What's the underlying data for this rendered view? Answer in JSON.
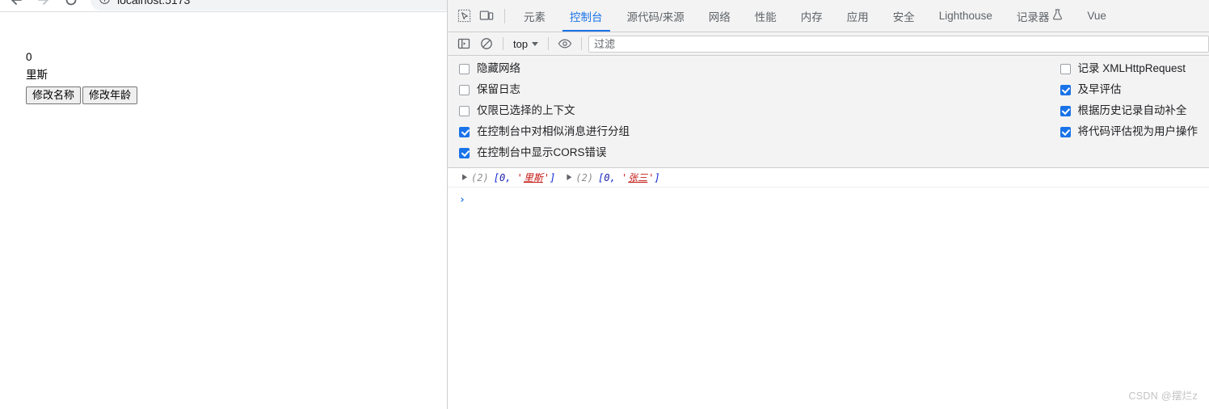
{
  "browser": {
    "url_text": "localhost:5173",
    "back_icon": "back-arrow-icon",
    "forward_icon": "forward-arrow-icon",
    "reload_icon": "reload-icon",
    "info_icon": "info-circle-icon"
  },
  "page": {
    "age_value": "0",
    "name_value": "里斯",
    "buttons": [
      {
        "label": "修改名称",
        "name": "change-name-button"
      },
      {
        "label": "修改年龄",
        "name": "change-age-button"
      }
    ]
  },
  "devtools": {
    "tabs": [
      {
        "label": "元素",
        "active": false
      },
      {
        "label": "控制台",
        "active": true
      },
      {
        "label": "源代码/来源",
        "active": false
      },
      {
        "label": "网络",
        "active": false
      },
      {
        "label": "性能",
        "active": false
      },
      {
        "label": "内存",
        "active": false
      },
      {
        "label": "应用",
        "active": false
      },
      {
        "label": "安全",
        "active": false
      },
      {
        "label": "Lighthouse",
        "active": false
      },
      {
        "label": "记录器",
        "active": false,
        "icon": "flask-icon"
      },
      {
        "label": "Vue",
        "active": false
      }
    ],
    "tabbar_icons": [
      {
        "name": "inspect-element-icon"
      },
      {
        "name": "device-toolbar-icon"
      }
    ],
    "console_toolbar": {
      "sidebar_toggle_icon": "console-sidebar-icon",
      "clear_console_icon": "clear-console-icon",
      "context_label": "top",
      "live_expression_icon": "eye-icon",
      "filter_placeholder": "过滤",
      "filter_value": ""
    },
    "settings": {
      "left": [
        {
          "label": "隐藏网络",
          "checked": false,
          "name": "setting-hide-network"
        },
        {
          "label": "保留日志",
          "checked": false,
          "name": "setting-preserve-log"
        },
        {
          "label": "仅限已选择的上下文",
          "checked": false,
          "name": "setting-selected-context-only"
        },
        {
          "label": "在控制台中对相似消息进行分组",
          "checked": true,
          "name": "setting-group-similar"
        },
        {
          "label": "在控制台中显示CORS错误",
          "checked": true,
          "name": "setting-show-cors-errors"
        }
      ],
      "right": [
        {
          "label": "记录 XMLHttpRequest",
          "checked": false,
          "name": "setting-log-xhr"
        },
        {
          "label": "及早评估",
          "checked": true,
          "name": "setting-eager-evaluation"
        },
        {
          "label": "根据历史记录自动补全",
          "checked": true,
          "name": "setting-autocomplete-from-history"
        },
        {
          "label": "将代码评估视为用户操作",
          "checked": true,
          "name": "setting-evaluate-as-user-action"
        }
      ]
    },
    "console_messages": [
      {
        "entries": [
          {
            "disclosure": "▶",
            "count": "(2)",
            "open_bracket": "[",
            "number": "0",
            "comma": ",",
            "quote_open": "'",
            "string": "里斯",
            "quote_close": "'",
            "close_bracket": "]"
          },
          {
            "disclosure": "▶",
            "count": "(2)",
            "open_bracket": "[",
            "number": "0",
            "comma": ",",
            "quote_open": "'",
            "string": "张三",
            "quote_close": "'",
            "close_bracket": "]"
          }
        ]
      }
    ],
    "prompt_chevron": "›"
  },
  "watermark": {
    "text": "CSDN @摆烂z"
  },
  "colors": {
    "accent_blue": "#1a73e8",
    "string_red": "#c41a16",
    "number_blue": "#1a1aa6",
    "panel_gray": "#f3f3f3",
    "border_gray": "#cdcdcd"
  }
}
